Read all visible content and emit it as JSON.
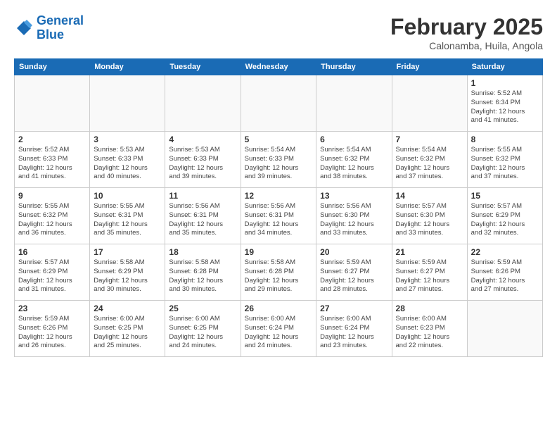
{
  "header": {
    "logo_line1": "General",
    "logo_line2": "Blue",
    "month_title": "February 2025",
    "location": "Calonamba, Huila, Angola"
  },
  "days_of_week": [
    "Sunday",
    "Monday",
    "Tuesday",
    "Wednesday",
    "Thursday",
    "Friday",
    "Saturday"
  ],
  "weeks": [
    [
      {
        "day": "",
        "info": ""
      },
      {
        "day": "",
        "info": ""
      },
      {
        "day": "",
        "info": ""
      },
      {
        "day": "",
        "info": ""
      },
      {
        "day": "",
        "info": ""
      },
      {
        "day": "",
        "info": ""
      },
      {
        "day": "1",
        "info": "Sunrise: 5:52 AM\nSunset: 6:34 PM\nDaylight: 12 hours\nand 41 minutes."
      }
    ],
    [
      {
        "day": "2",
        "info": "Sunrise: 5:52 AM\nSunset: 6:33 PM\nDaylight: 12 hours\nand 41 minutes."
      },
      {
        "day": "3",
        "info": "Sunrise: 5:53 AM\nSunset: 6:33 PM\nDaylight: 12 hours\nand 40 minutes."
      },
      {
        "day": "4",
        "info": "Sunrise: 5:53 AM\nSunset: 6:33 PM\nDaylight: 12 hours\nand 39 minutes."
      },
      {
        "day": "5",
        "info": "Sunrise: 5:54 AM\nSunset: 6:33 PM\nDaylight: 12 hours\nand 39 minutes."
      },
      {
        "day": "6",
        "info": "Sunrise: 5:54 AM\nSunset: 6:32 PM\nDaylight: 12 hours\nand 38 minutes."
      },
      {
        "day": "7",
        "info": "Sunrise: 5:54 AM\nSunset: 6:32 PM\nDaylight: 12 hours\nand 37 minutes."
      },
      {
        "day": "8",
        "info": "Sunrise: 5:55 AM\nSunset: 6:32 PM\nDaylight: 12 hours\nand 37 minutes."
      }
    ],
    [
      {
        "day": "9",
        "info": "Sunrise: 5:55 AM\nSunset: 6:32 PM\nDaylight: 12 hours\nand 36 minutes."
      },
      {
        "day": "10",
        "info": "Sunrise: 5:55 AM\nSunset: 6:31 PM\nDaylight: 12 hours\nand 35 minutes."
      },
      {
        "day": "11",
        "info": "Sunrise: 5:56 AM\nSunset: 6:31 PM\nDaylight: 12 hours\nand 35 minutes."
      },
      {
        "day": "12",
        "info": "Sunrise: 5:56 AM\nSunset: 6:31 PM\nDaylight: 12 hours\nand 34 minutes."
      },
      {
        "day": "13",
        "info": "Sunrise: 5:56 AM\nSunset: 6:30 PM\nDaylight: 12 hours\nand 33 minutes."
      },
      {
        "day": "14",
        "info": "Sunrise: 5:57 AM\nSunset: 6:30 PM\nDaylight: 12 hours\nand 33 minutes."
      },
      {
        "day": "15",
        "info": "Sunrise: 5:57 AM\nSunset: 6:29 PM\nDaylight: 12 hours\nand 32 minutes."
      }
    ],
    [
      {
        "day": "16",
        "info": "Sunrise: 5:57 AM\nSunset: 6:29 PM\nDaylight: 12 hours\nand 31 minutes."
      },
      {
        "day": "17",
        "info": "Sunrise: 5:58 AM\nSunset: 6:29 PM\nDaylight: 12 hours\nand 30 minutes."
      },
      {
        "day": "18",
        "info": "Sunrise: 5:58 AM\nSunset: 6:28 PM\nDaylight: 12 hours\nand 30 minutes."
      },
      {
        "day": "19",
        "info": "Sunrise: 5:58 AM\nSunset: 6:28 PM\nDaylight: 12 hours\nand 29 minutes."
      },
      {
        "day": "20",
        "info": "Sunrise: 5:59 AM\nSunset: 6:27 PM\nDaylight: 12 hours\nand 28 minutes."
      },
      {
        "day": "21",
        "info": "Sunrise: 5:59 AM\nSunset: 6:27 PM\nDaylight: 12 hours\nand 27 minutes."
      },
      {
        "day": "22",
        "info": "Sunrise: 5:59 AM\nSunset: 6:26 PM\nDaylight: 12 hours\nand 27 minutes."
      }
    ],
    [
      {
        "day": "23",
        "info": "Sunrise: 5:59 AM\nSunset: 6:26 PM\nDaylight: 12 hours\nand 26 minutes."
      },
      {
        "day": "24",
        "info": "Sunrise: 6:00 AM\nSunset: 6:25 PM\nDaylight: 12 hours\nand 25 minutes."
      },
      {
        "day": "25",
        "info": "Sunrise: 6:00 AM\nSunset: 6:25 PM\nDaylight: 12 hours\nand 24 minutes."
      },
      {
        "day": "26",
        "info": "Sunrise: 6:00 AM\nSunset: 6:24 PM\nDaylight: 12 hours\nand 24 minutes."
      },
      {
        "day": "27",
        "info": "Sunrise: 6:00 AM\nSunset: 6:24 PM\nDaylight: 12 hours\nand 23 minutes."
      },
      {
        "day": "28",
        "info": "Sunrise: 6:00 AM\nSunset: 6:23 PM\nDaylight: 12 hours\nand 22 minutes."
      },
      {
        "day": "",
        "info": ""
      }
    ]
  ]
}
